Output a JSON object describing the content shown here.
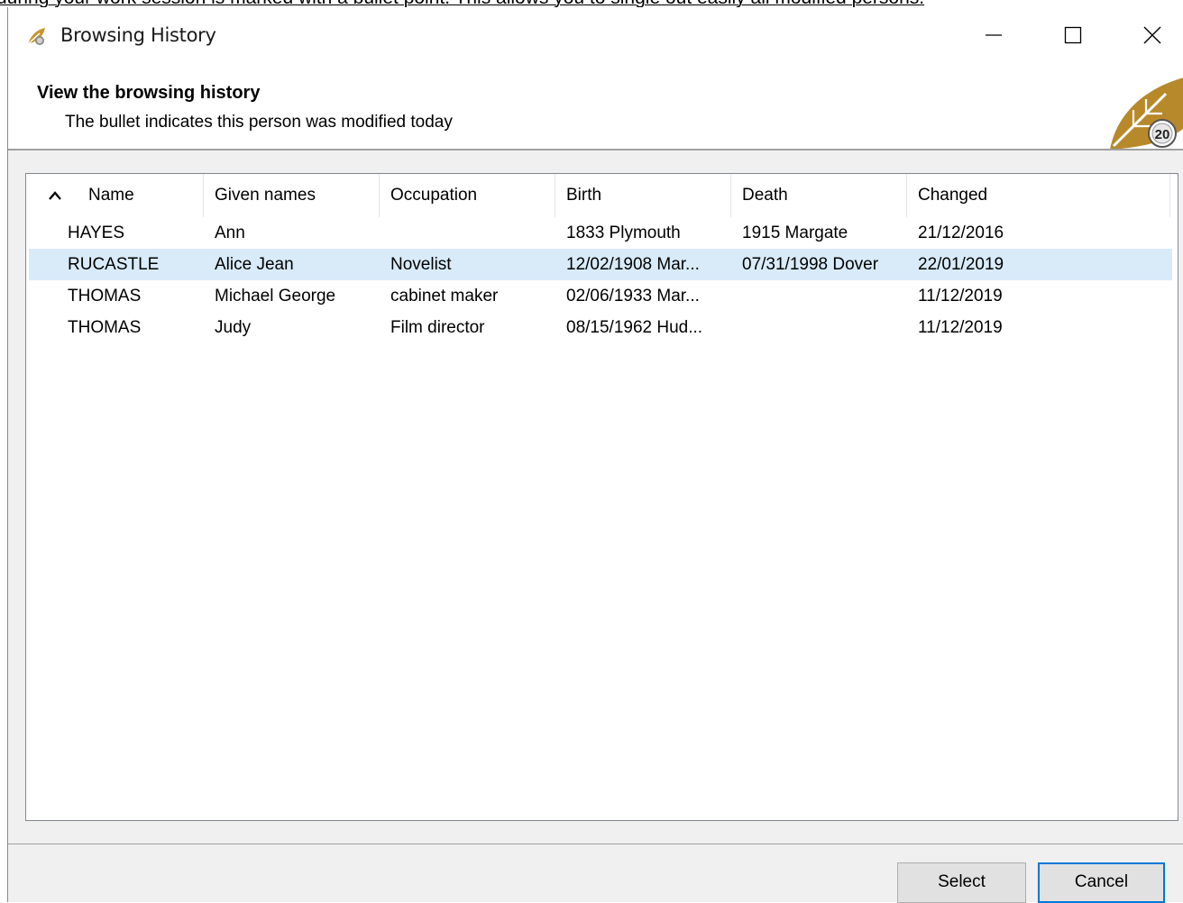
{
  "page_top_text": "during your work session is marked with a bullet point. This allows you to single out easily all modified persons.",
  "window": {
    "title": "Browsing History",
    "app_icon": "leaf-icon",
    "controls": {
      "minimize_icon": "minimize-icon",
      "maximize_icon": "maximize-icon",
      "close_icon": "close-icon"
    }
  },
  "header": {
    "title": "View the browsing history",
    "subtitle": "The bullet indicates this person was modified today",
    "logo_icon": "leaf-2020-logo",
    "logo_text": "20"
  },
  "table": {
    "sort_icon": "sort-ascending-icon",
    "columns": [
      "Name",
      "Given names",
      "Occupation",
      "Birth",
      "Death",
      "Changed"
    ],
    "rows": [
      {
        "name": "HAYES",
        "given": "Ann",
        "occupation": "",
        "birth": "1833 Plymouth",
        "death": "1915 Margate",
        "changed": "21/12/2016",
        "selected": false
      },
      {
        "name": "RUCASTLE",
        "given": "Alice Jean",
        "occupation": "Novelist",
        "birth": "12/02/1908 Mar...",
        "death": "07/31/1998 Dover",
        "changed": "22/01/2019",
        "selected": true
      },
      {
        "name": "THOMAS",
        "given": "Michael George",
        "occupation": "cabinet maker",
        "birth": "02/06/1933 Mar...",
        "death": "",
        "changed": "11/12/2019",
        "selected": false
      },
      {
        "name": "THOMAS",
        "given": "Judy",
        "occupation": "Film director",
        "birth": "08/15/1962 Hud...",
        "death": "",
        "changed": "11/12/2019",
        "selected": false
      }
    ]
  },
  "buttons": {
    "select_label": "Select",
    "cancel_label": "Cancel"
  },
  "colors": {
    "selected_row": "#d9ebf9",
    "focus_border": "#0078d7",
    "logo_gold": "#b8892a"
  }
}
